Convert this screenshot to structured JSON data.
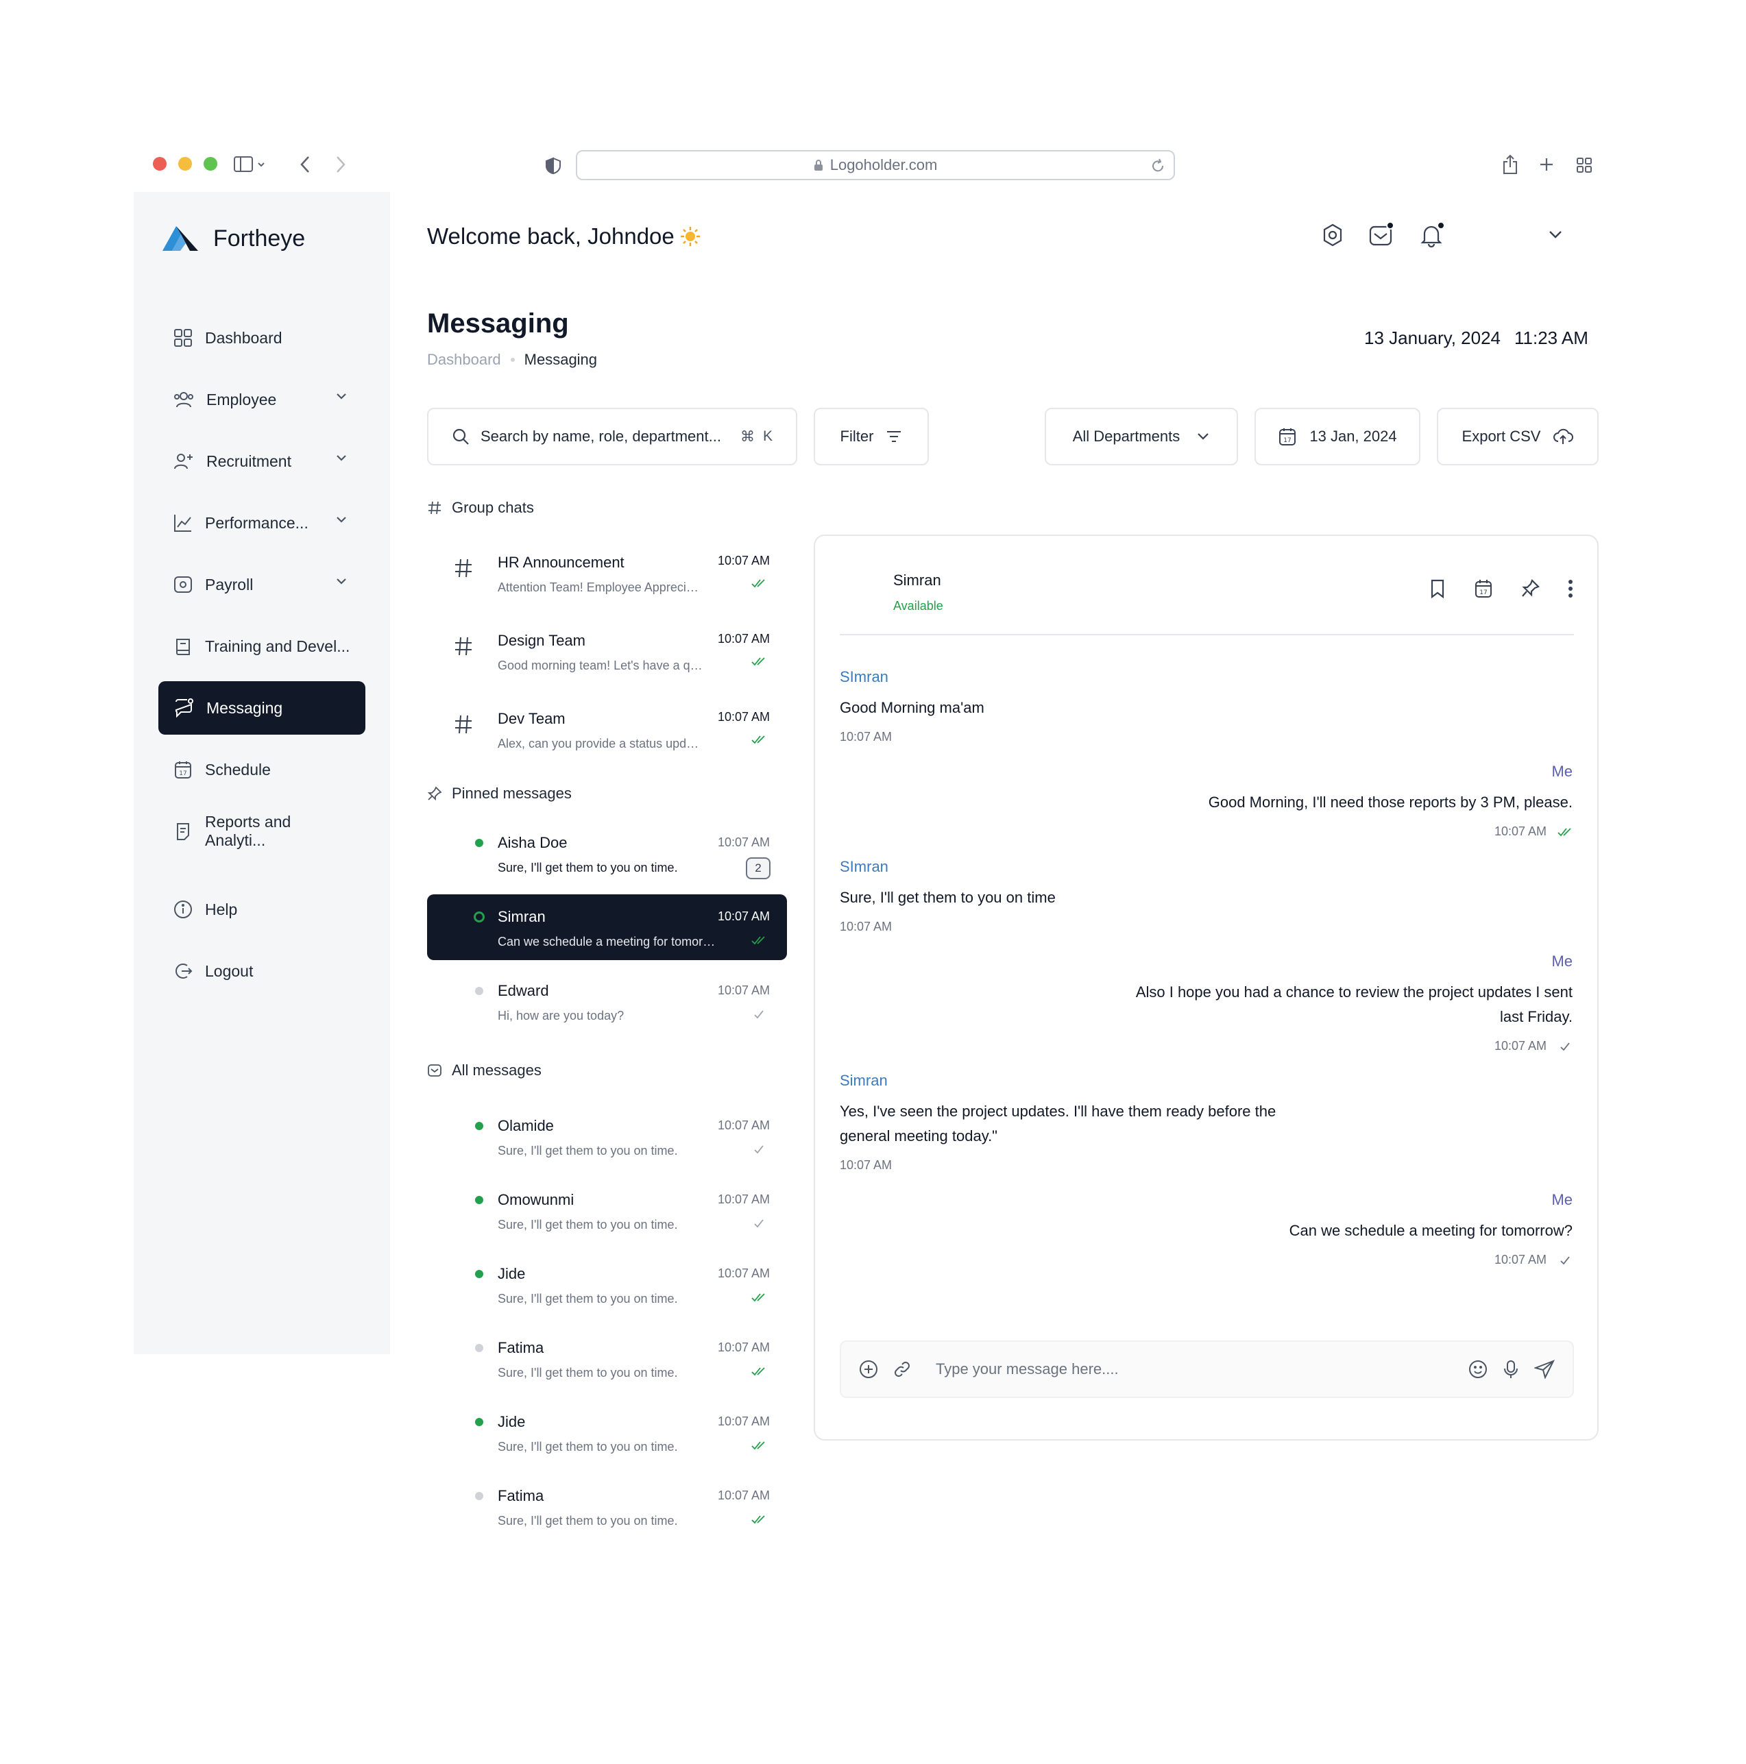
{
  "browser": {
    "url": "Logoholder.com",
    "traffic_colors": [
      "#ec5f55",
      "#f5bd3d",
      "#5ec44f"
    ]
  },
  "sidebar": {
    "brand": "Fortheye",
    "items": [
      {
        "label": "Dashboard",
        "icon": "grid-icon",
        "chevron": false
      },
      {
        "label": "Employee",
        "icon": "users-icon",
        "chevron": true
      },
      {
        "label": "Recruitment",
        "icon": "user-plus-icon",
        "chevron": true
      },
      {
        "label": "Performance...",
        "icon": "chart-icon",
        "chevron": true
      },
      {
        "label": "Payroll",
        "icon": "wallet-icon",
        "chevron": true
      },
      {
        "label": "Training and Devel...",
        "icon": "book-icon",
        "chevron": false
      },
      {
        "label": "Messaging",
        "icon": "chat-icon",
        "chevron": false,
        "active": true
      },
      {
        "label": "Schedule",
        "icon": "calendar-icon",
        "chevron": false
      },
      {
        "label": "Reports and Analyti...",
        "icon": "report-icon",
        "chevron": false
      }
    ],
    "bottom": [
      {
        "label": "Help",
        "icon": "info-icon"
      },
      {
        "label": "Logout",
        "icon": "logout-icon"
      }
    ]
  },
  "header": {
    "welcome": "Welcome back, Johndoe",
    "title": "Messaging",
    "breadcrumb": [
      "Dashboard",
      "Messaging"
    ],
    "date": "13 January, 2024",
    "time": "11:23 AM"
  },
  "toolbar": {
    "search_placeholder": "Search by name, role, department...",
    "shortcut_symbol": "⌘",
    "shortcut_key": "K",
    "filter": "Filter",
    "department": "All Departments",
    "date": "13 Jan, 2024",
    "export": "Export CSV"
  },
  "sections": {
    "group": "Group chats",
    "pinned": "Pinned messages",
    "all": "All messages"
  },
  "group_chats": [
    {
      "name": "HR Announcement",
      "preview": "Attention Team! Employee Appreciation Week",
      "time": "10:07 AM"
    },
    {
      "name": "Design Team",
      "preview": "Good morning team! Let's have a quick sync",
      "time": "10:07 AM"
    },
    {
      "name": "Dev Team",
      "preview": "Alex, can you provide a status update on the API",
      "time": "10:07 AM"
    }
  ],
  "pinned": [
    {
      "name": "Aisha Doe",
      "preview": "Sure, I'll get them to you on time.",
      "time": "10:07 AM",
      "badge": "2",
      "online": true
    },
    {
      "name": "Simran",
      "preview": "Can we schedule a meeting for tomorrow?",
      "time": "10:07 AM",
      "online": true,
      "active": true,
      "read": true
    },
    {
      "name": "Edward",
      "preview": "Hi, how are you today?",
      "time": "10:07 AM",
      "online": false,
      "read": false
    }
  ],
  "all_messages": [
    {
      "name": "Olamide",
      "preview": "Sure, I'll get them to you on time.",
      "time": "10:07 AM",
      "online": true,
      "read": false
    },
    {
      "name": "Omowunmi",
      "preview": "Sure, I'll get them to you on time.",
      "time": "10:07 AM",
      "online": true,
      "read": false
    },
    {
      "name": "Jide",
      "preview": "Sure, I'll get them to you on time.",
      "time": "10:07 AM",
      "online": true,
      "read": true
    },
    {
      "name": "Fatima",
      "preview": "Sure, I'll get them to you on time.",
      "time": "10:07 AM",
      "online": false,
      "read": true
    },
    {
      "name": "Jide",
      "preview": "Sure, I'll get them to you on time.",
      "time": "10:07 AM",
      "online": true,
      "read": true
    },
    {
      "name": "Fatima",
      "preview": "Sure, I'll get them to you on time.",
      "time": "10:07 AM",
      "online": false,
      "read": true
    }
  ],
  "chat": {
    "contact": "Simran",
    "status": "Available",
    "messages": [
      {
        "dir": "in",
        "sender": "SImran",
        "text": "Good Morning ma'am",
        "time": "10:07 AM"
      },
      {
        "dir": "out",
        "sender": "Me",
        "text": "Good Morning, I'll need those reports by 3 PM, please.",
        "time": "10:07 AM",
        "read": true
      },
      {
        "dir": "in",
        "sender": "SImran",
        "text": "Sure, I'll get them to you on time",
        "time": "10:07 AM"
      },
      {
        "dir": "out",
        "sender": "Me",
        "text": "Also I hope you had a chance to review the project updates I sent last Friday.",
        "time": "10:07 AM",
        "read": false
      },
      {
        "dir": "in",
        "sender": "Simran",
        "text": "Yes, I've seen the project updates. I'll have them ready before the general meeting today.\"",
        "time": "10:07 AM"
      },
      {
        "dir": "out",
        "sender": "Me",
        "text": "Can we schedule a meeting for tomorrow?",
        "time": "10:07 AM",
        "read": false
      }
    ],
    "composer_placeholder": "Type your message here...."
  },
  "colors": {
    "online": "#22a04b",
    "offline": "#cfd2d6",
    "active_bg": "#111827",
    "read_check": "#22a04b"
  }
}
